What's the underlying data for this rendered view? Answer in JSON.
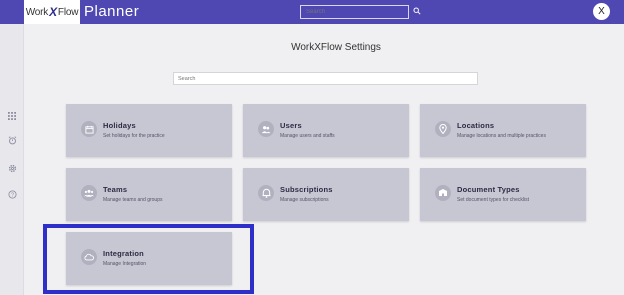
{
  "header": {
    "logo_left": "Work",
    "logo_x": "X",
    "logo_right": "Flow",
    "app_title": "Planner",
    "search_placeholder": "Search",
    "avatar_initial": "X"
  },
  "sidebar": {
    "items": [
      {
        "icon": "grid-icon"
      },
      {
        "icon": "alarm-icon"
      },
      {
        "icon": "gear-icon"
      },
      {
        "icon": "help-icon"
      }
    ]
  },
  "main": {
    "title": "WorkXFlow Settings",
    "search_placeholder": "Search",
    "cards": [
      {
        "title": "Holidays",
        "desc": "Set holidays for the practice",
        "icon": "calendar-icon"
      },
      {
        "title": "Users",
        "desc": "Manage users and staffs",
        "icon": "users-icon"
      },
      {
        "title": "Locations",
        "desc": "Manage locations and multiple practices",
        "icon": "location-pin-icon"
      },
      {
        "title": "Teams",
        "desc": "Manage teams and groups",
        "icon": "team-icon"
      },
      {
        "title": "Subscriptions",
        "desc": "Manage subscriptions",
        "icon": "bell-icon"
      },
      {
        "title": "Document Types",
        "desc": "Set document types for checklist",
        "icon": "document-types-icon"
      },
      {
        "title": "Integration",
        "desc": "Manage Integration",
        "icon": "cloud-icon"
      }
    ]
  },
  "colors": {
    "header": "#5048b2",
    "card": "#c7c6d3",
    "highlight": "#2e2ec8"
  }
}
